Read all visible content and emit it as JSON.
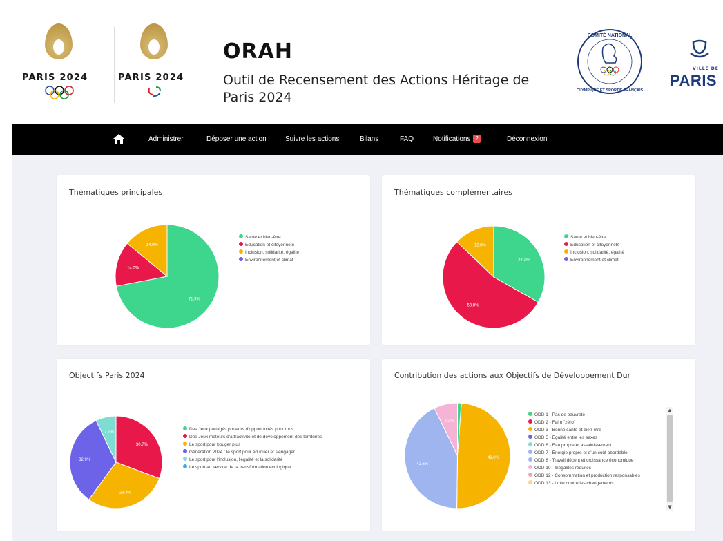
{
  "header": {
    "logo_olympic_text": "PARIS 2024",
    "logo_paralympic_text": "PARIS 2024",
    "title": "ORAH",
    "subtitle": "Outil de Recensement des Actions Héritage de Paris 2024",
    "cno_top_text": "COMITÉ NATIONAL",
    "cno_bottom_text": "OLYMPIQUE ET SPORTIF FRANÇAIS",
    "vdp_small": "VILLE DE",
    "vdp_big": "PARIS"
  },
  "nav": {
    "home_icon": "home-icon",
    "items": [
      "Administrer",
      "Déposer une action",
      "Suivre les actions",
      "Bilans",
      "FAQ",
      "Notifications",
      "Déconnexion"
    ],
    "notifications_count": "2"
  },
  "colors": {
    "green": "#3dd68c",
    "red": "#e8184a",
    "orange": "#f6b400",
    "purple": "#6c63e8",
    "teal": "#7fdcd2",
    "blue": "#3fa9e8",
    "lightblue": "#9fb5f0",
    "pink": "#f5b3d6",
    "nav_bg": "#000000",
    "badge": "#e84c4c"
  },
  "chart_data": [
    {
      "type": "pie",
      "title": "Thématiques principales",
      "categories": [
        "Santé et bien-être",
        "Education et citoyenneté",
        "Inclusion, solidarité, égalité",
        "Environnement et climat"
      ],
      "values": [
        71.9,
        14.0,
        14.0,
        0
      ],
      "labels": [
        "71.9%",
        "14.0%",
        "14.0%",
        ""
      ],
      "colors": [
        "#3dd68c",
        "#e8184a",
        "#f6b400",
        "#6c63e8"
      ]
    },
    {
      "type": "pie",
      "title": "Thématiques complémentaires",
      "categories": [
        "Santé et bien-être",
        "Education et citoyenneté",
        "Inclusion, solidarité, égalité",
        "Environnement et climat"
      ],
      "values": [
        33.1,
        53.8,
        12.8,
        0
      ],
      "labels": [
        "33.1%",
        "53.8%",
        "12.8%",
        ""
      ],
      "colors": [
        "#3dd68c",
        "#e8184a",
        "#f6b400",
        "#6c63e8"
      ]
    },
    {
      "type": "pie",
      "title": "Objectifs Paris 2024",
      "categories": [
        "Des Jeux partagés porteurs d'opportunités pour tous",
        "Des Jeux moteurs d'attractivité et de développement des territoires",
        "Le sport pour bouger plus",
        "Génération 2024 : le sport pour éduquer et s'engager",
        "Le sport pour l'inclusion, l'égalité et la solidarité",
        "Le sport au service de la transformation écologique"
      ],
      "values": [
        0,
        30.7,
        29.3,
        32.9,
        7.1,
        0
      ],
      "labels": [
        "",
        "30.7%",
        "29.3%",
        "32.9%",
        "7.1%",
        ""
      ],
      "colors": [
        "#3dd68c",
        "#e8184a",
        "#f6b400",
        "#6c63e8",
        "#7fdcd2",
        "#3fa9e8"
      ]
    },
    {
      "type": "pie",
      "title": "Contribution des actions aux Objectifs de Développement Dur",
      "categories": [
        "ODD 1 - Pas de pauvreté",
        "ODD 2 - Faim \"zéro\"",
        "ODD 3 - Bonne santé et bien-être",
        "ODD 5 - Égalité entre les sexes",
        "ODD 6 - Eau propre et assainissement",
        "ODD 7 - Énergie propre et d'un coût abordable",
        "ODD 8 - Travail décent et croissance économique",
        "ODD 10 - Inégalités réduites",
        "ODD 12 - Consommation et production responsables",
        "ODD 13 - Lutte contre les changements"
      ],
      "values": [
        1.2,
        0,
        49.0,
        0,
        0,
        0,
        42.6,
        7.2,
        0,
        0
      ],
      "labels": [
        "",
        "",
        "49.0%",
        "",
        "",
        "",
        "42.6%",
        "7.2%",
        "",
        ""
      ],
      "colors": [
        "#3dd68c",
        "#e8184a",
        "#f6b400",
        "#6c63e8",
        "#7fdcd2",
        "#9fb5f0",
        "#9fb5f0",
        "#f5b3d6",
        "#f4a3a8",
        "#f6d88c"
      ]
    }
  ]
}
